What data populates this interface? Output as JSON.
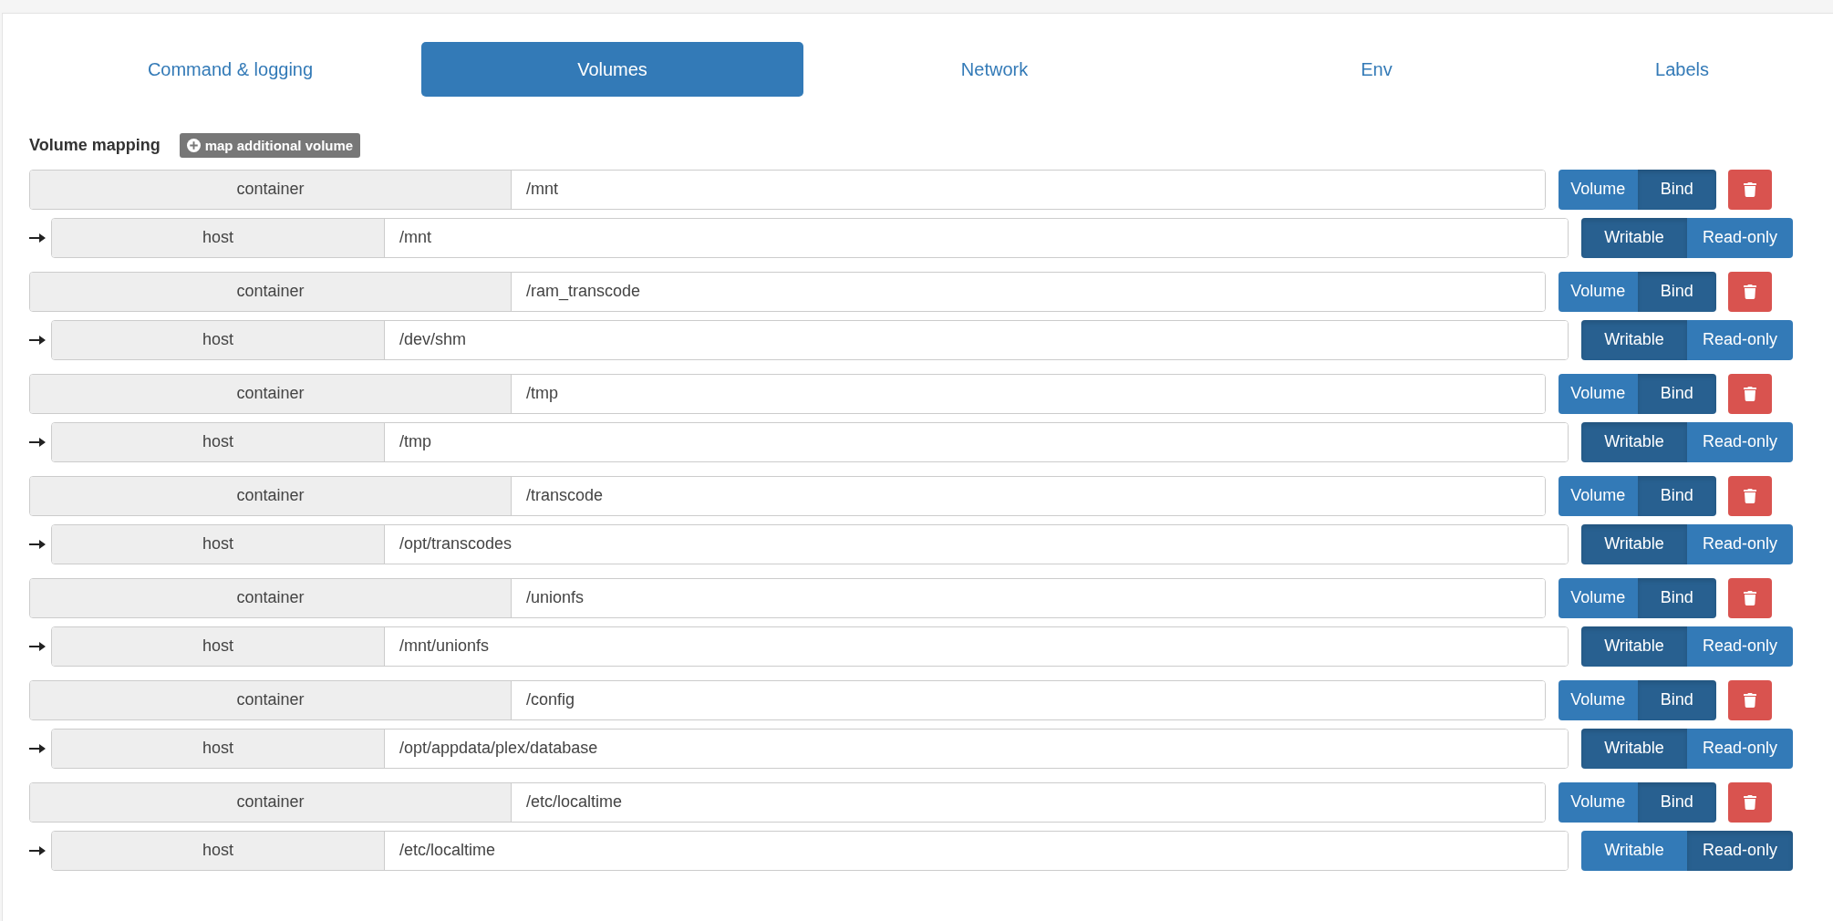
{
  "tabs": [
    {
      "label": "Command & logging",
      "selected": false
    },
    {
      "label": "Volumes",
      "selected": true
    },
    {
      "label": "Network",
      "selected": false
    },
    {
      "label": "Env",
      "selected": false
    },
    {
      "label": "Labels",
      "selected": false
    }
  ],
  "volume_mapping": {
    "title": "Volume mapping",
    "add_button": "map additional volume",
    "mappings": [
      {
        "container_label": "container",
        "container_path": "/mnt",
        "type_options": [
          {
            "label": "Volume",
            "selected": false
          },
          {
            "label": "Bind",
            "selected": true
          }
        ],
        "host_label": "host",
        "host_path": "/mnt",
        "access_options": [
          {
            "label": "Writable",
            "selected": true
          },
          {
            "label": "Read-only",
            "selected": false
          }
        ]
      },
      {
        "container_label": "container",
        "container_path": "/ram_transcode",
        "type_options": [
          {
            "label": "Volume",
            "selected": false
          },
          {
            "label": "Bind",
            "selected": true
          }
        ],
        "host_label": "host",
        "host_path": "/dev/shm",
        "access_options": [
          {
            "label": "Writable",
            "selected": true
          },
          {
            "label": "Read-only",
            "selected": false
          }
        ]
      },
      {
        "container_label": "container",
        "container_path": "/tmp",
        "type_options": [
          {
            "label": "Volume",
            "selected": false
          },
          {
            "label": "Bind",
            "selected": true
          }
        ],
        "host_label": "host",
        "host_path": "/tmp",
        "access_options": [
          {
            "label": "Writable",
            "selected": true
          },
          {
            "label": "Read-only",
            "selected": false
          }
        ]
      },
      {
        "container_label": "container",
        "container_path": "/transcode",
        "type_options": [
          {
            "label": "Volume",
            "selected": false
          },
          {
            "label": "Bind",
            "selected": true
          }
        ],
        "host_label": "host",
        "host_path": "/opt/transcodes",
        "access_options": [
          {
            "label": "Writable",
            "selected": true
          },
          {
            "label": "Read-only",
            "selected": false
          }
        ]
      },
      {
        "container_label": "container",
        "container_path": "/unionfs",
        "type_options": [
          {
            "label": "Volume",
            "selected": false
          },
          {
            "label": "Bind",
            "selected": true
          }
        ],
        "host_label": "host",
        "host_path": "/mnt/unionfs",
        "access_options": [
          {
            "label": "Writable",
            "selected": true
          },
          {
            "label": "Read-only",
            "selected": false
          }
        ]
      },
      {
        "container_label": "container",
        "container_path": "/config",
        "type_options": [
          {
            "label": "Volume",
            "selected": false
          },
          {
            "label": "Bind",
            "selected": true
          }
        ],
        "host_label": "host",
        "host_path": "/opt/appdata/plex/database",
        "access_options": [
          {
            "label": "Writable",
            "selected": true
          },
          {
            "label": "Read-only",
            "selected": false
          }
        ]
      },
      {
        "container_label": "container",
        "container_path": "/etc/localtime",
        "type_options": [
          {
            "label": "Volume",
            "selected": false
          },
          {
            "label": "Bind",
            "selected": true
          }
        ],
        "host_label": "host",
        "host_path": "/etc/localtime",
        "access_options": [
          {
            "label": "Writable",
            "selected": false
          },
          {
            "label": "Read-only",
            "selected": true
          }
        ]
      }
    ]
  }
}
